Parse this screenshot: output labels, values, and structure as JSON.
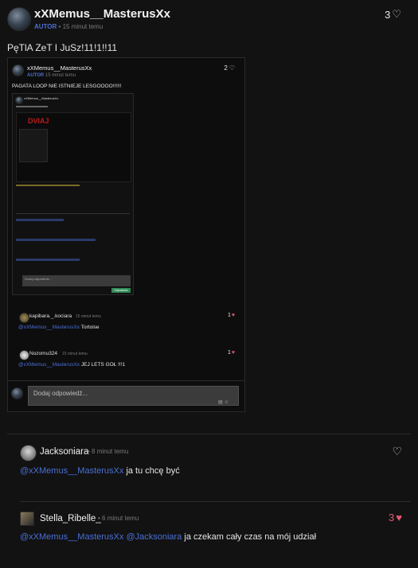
{
  "main_post": {
    "username": "xXMemus__MasterusXx",
    "role_badge": "AUTOR",
    "time": "15 minut temu",
    "likes": "3",
    "text": "PęTlA ZeT I JuSz!11!1!!11"
  },
  "embed": {
    "username": "xXMemus__MasterusXx",
    "role_badge": "AUTOR",
    "time": "15 minut temu",
    "likes": "2",
    "text": "PAGATA LOOP NIE ISTNIEJE LESGOOOO!!!!!!",
    "nested_screenshot": {
      "username": "xXMemus__MasterusXx",
      "stamp_text": "DVIAJ",
      "input_placeholder": "Dodaj odpowiedź...",
      "button_label": "Odpowiedz"
    },
    "comments": [
      {
        "username": "kapibara._.kociara",
        "time": "15 minut temu",
        "likes": "1",
        "mention": "@xXMemus__MasterusXx",
        "text": "Tortoise"
      },
      {
        "username": "Nozomu324",
        "time": "15 minut temu",
        "likes": "1",
        "mention": "@xXMemus__MasterusXx",
        "text": "JEJ LETS GOŁ !!!1"
      }
    ],
    "reply_placeholder": "Dodaj odpowiedź..."
  },
  "comments": [
    {
      "username": "Jacksoniara",
      "time": "8 minut temu",
      "likes": "",
      "mentions": [
        "@xXMemus__MasterusXx"
      ],
      "text": "ja tu chcę być"
    },
    {
      "username": "Stella_Ribelle_",
      "time": "6 minut temu",
      "likes": "3",
      "mentions": [
        "@xXMemus__MasterusXx",
        "@Jacksoniara"
      ],
      "text": "ja czekam cały czas na mój udział"
    }
  ],
  "colors": {
    "background": "#121212",
    "link": "#4a6fd8",
    "heart": "#e05a6e",
    "badge": "#4a6fd8"
  }
}
